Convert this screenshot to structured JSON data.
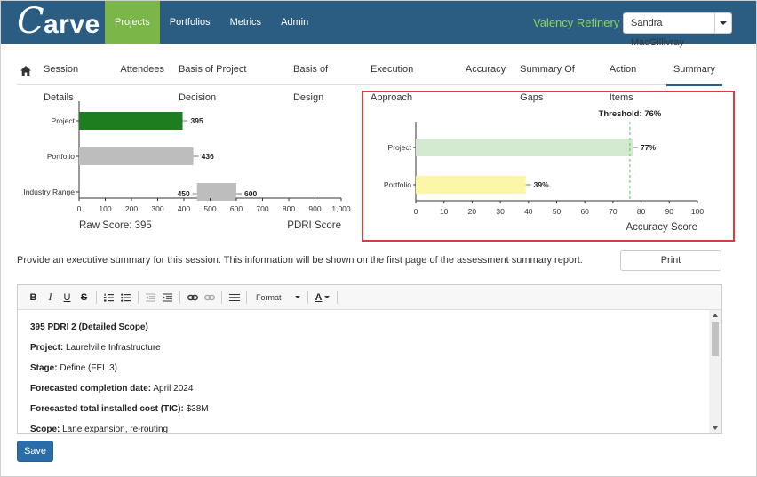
{
  "app": {
    "logo_big": "C",
    "logo_rest": "arve",
    "nav": [
      "Projects",
      "Portfolios",
      "Metrics",
      "Admin"
    ],
    "site_name": "Valency Refinery",
    "user_name": "Sandra MacGillivray"
  },
  "tabs": [
    "Session Details",
    "Attendees",
    "Basis of Project Decision",
    "Basis of Design",
    "Execution Approach",
    "Accuracy",
    "Summary Of Gaps",
    "Action Items",
    "Summary"
  ],
  "active_tab": "Summary",
  "chart_data": [
    {
      "type": "bar",
      "orientation": "horizontal",
      "categories": [
        "Project",
        "Portfolio",
        "Industry Range"
      ],
      "values": [
        395,
        436,
        [
          450,
          600
        ]
      ],
      "colors": [
        "#1e7e1e",
        "#bdbdbd",
        "#bdbdbd"
      ],
      "xlim": [
        0,
        1000
      ],
      "xticks": [
        "0",
        "100",
        "200",
        "300",
        "400",
        "500",
        "600",
        "700",
        "800",
        "900",
        "1,000"
      ],
      "caption_left": "Raw Score: 395",
      "xlabel": "PDRI Score"
    },
    {
      "type": "bar",
      "orientation": "horizontal",
      "categories": [
        "Project",
        "Portfolio"
      ],
      "values": [
        77,
        39
      ],
      "labels": [
        "77%",
        "39%"
      ],
      "colors": [
        "#d4ead0",
        "#fbf6a8"
      ],
      "xlim": [
        0,
        100
      ],
      "xticks": [
        "0",
        "10",
        "20",
        "30",
        "40",
        "50",
        "60",
        "70",
        "80",
        "90",
        "100"
      ],
      "threshold": 76,
      "threshold_label": "Threshold: 76%",
      "xlabel": "Accuracy Score"
    }
  ],
  "summary_prompt": "Provide an executive summary for this session. This information will be shown on the first page of the assessment summary report.",
  "print_label": "Print",
  "toolbar": {
    "bold": "B",
    "italic": "I",
    "underline": "U",
    "strike": "S",
    "format_label": "Format",
    "font_color": "A"
  },
  "editor": {
    "heading": "395 PDRI 2 (Detailed Scope)",
    "fields": [
      {
        "label": "Project:",
        "value": "Laurelville Infrastructure"
      },
      {
        "label": "Stage:",
        "value": "Define (FEL 3)"
      },
      {
        "label": "Forecasted completion date:",
        "value": "April 2024"
      },
      {
        "label": "Forecasted total installed cost (TIC):",
        "value": "$38M"
      },
      {
        "label": "Scope:",
        "value": "Lane expansion, re-routing"
      }
    ]
  },
  "save_label": "Save"
}
